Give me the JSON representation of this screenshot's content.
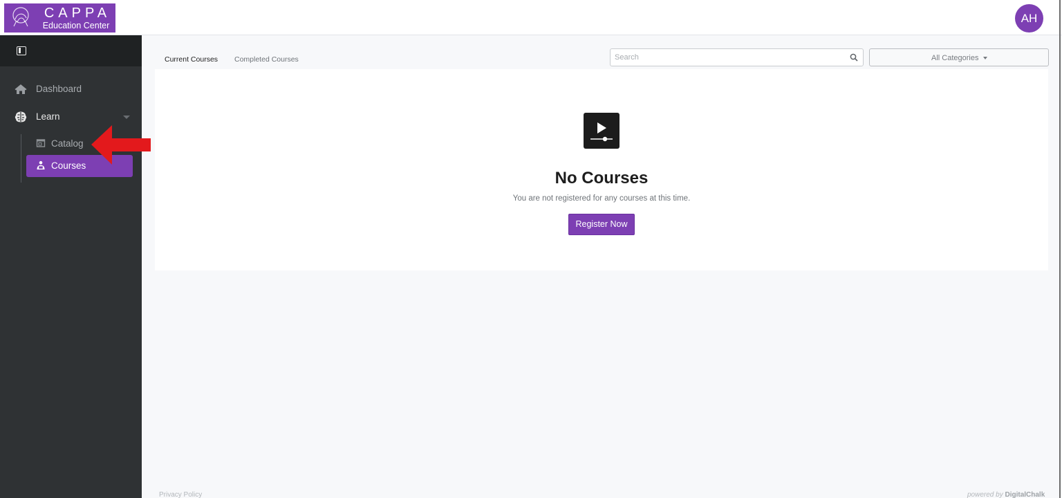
{
  "brand": {
    "name": "CAPPA",
    "subtitle": "Education Center",
    "color": "#7d3fb3"
  },
  "user": {
    "initials": "AH"
  },
  "sidebar": {
    "toggle_icon": "sidebar-toggle-icon",
    "items": [
      {
        "label": "Dashboard",
        "icon": "home-icon"
      },
      {
        "label": "Learn",
        "icon": "brain-icon",
        "expanded": true
      }
    ],
    "subitems": [
      {
        "label": "Catalog",
        "icon": "catalog-icon",
        "active": false
      },
      {
        "label": "Courses",
        "icon": "courses-icon",
        "active": true
      }
    ]
  },
  "main": {
    "tabs": [
      {
        "label": "Current Courses",
        "active": true
      },
      {
        "label": "Completed Courses",
        "active": false
      }
    ],
    "search": {
      "placeholder": "Search",
      "value": ""
    },
    "category_filter": {
      "selected": "All Categories"
    },
    "empty_state": {
      "icon": "video-player-icon",
      "title": "No Courses",
      "message": "You are not registered for any courses at this time.",
      "button_label": "Register Now"
    }
  },
  "footer": {
    "privacy": "Privacy Policy",
    "powered_prefix": "powered by",
    "powered_brand": "DigitalChalk"
  },
  "annotation": {
    "color": "#e3191c",
    "points_to": "Catalog"
  }
}
